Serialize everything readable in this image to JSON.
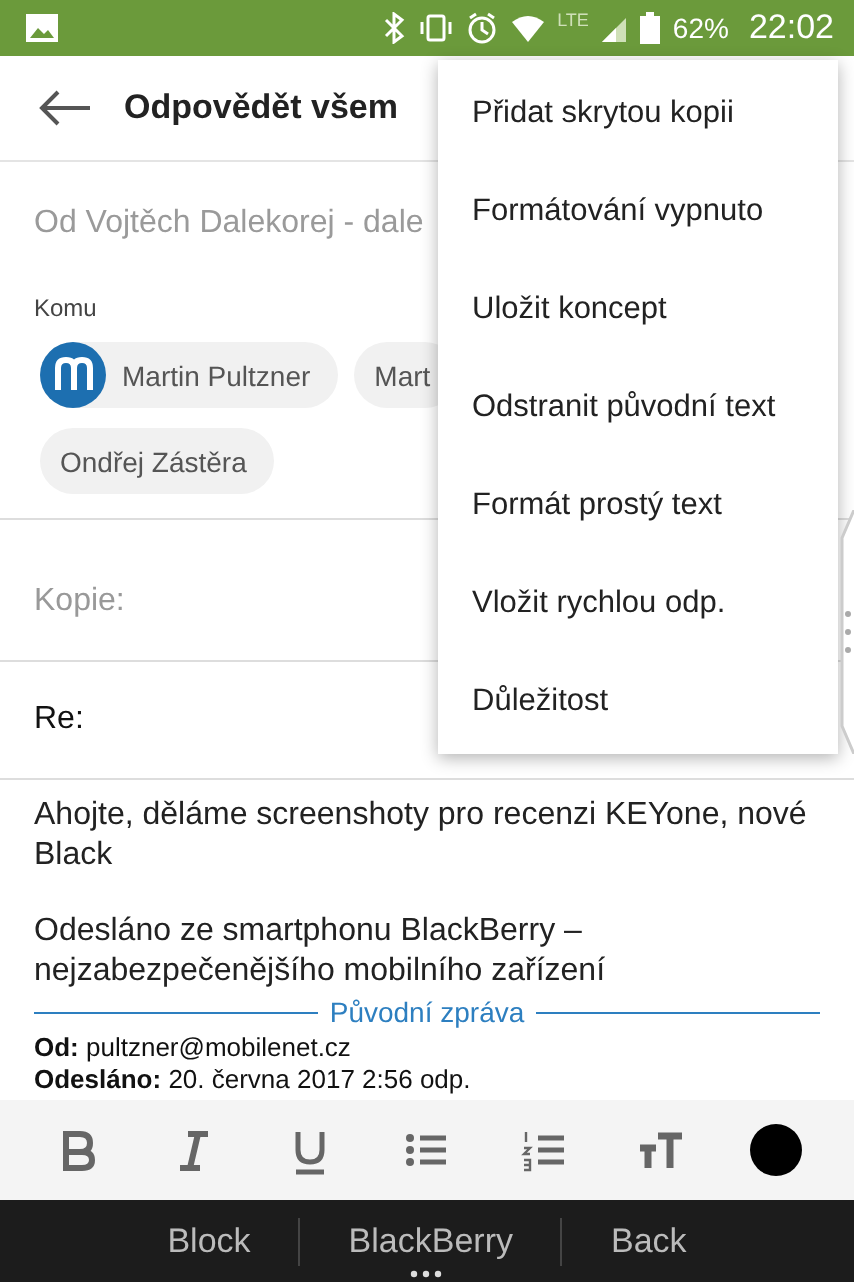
{
  "status_bar": {
    "network": "LTE",
    "battery": "62%",
    "time": "22:02"
  },
  "app_bar": {
    "title": "Odpovědět všem"
  },
  "from": {
    "label": "Od",
    "value": "Vojtěch Dalekorej - dale"
  },
  "to": {
    "label": "Komu",
    "recipients": [
      {
        "name": "Martin Pultzner",
        "kind": "avatar"
      },
      {
        "name": "Mart",
        "kind": "plain"
      },
      {
        "name": "Ondřej Zástěra",
        "kind": "plain"
      }
    ]
  },
  "cc": {
    "placeholder": "Kopie:"
  },
  "subject": {
    "value": "Re:"
  },
  "body": {
    "paragraphs": [
      "Ahojte, děláme screenshoty pro recenzi KEYone, nové Black",
      "Odesláno ze smartphonu BlackBerry – nejzabezpečenějšího mobilního zařízení"
    ],
    "divider_label": "Původní zpráva",
    "header_lines": [
      "**Od:** pultzner@mobilenet.cz",
      "**Odesláno:** 20. června 2017 2:56 odp."
    ]
  },
  "format_toolbar": [
    {
      "kind": "bold"
    },
    {
      "kind": "italic"
    },
    {
      "kind": "underline"
    },
    {
      "kind": "bullets"
    },
    {
      "kind": "numbers"
    },
    {
      "kind": "size"
    },
    {
      "kind": "color",
      "color": "#000000"
    }
  ],
  "menu": {
    "items": [
      "Přidat skrytou kopii",
      "Formátování vypnuto",
      "Uložit koncept",
      "Odstranit původní text",
      "Formát prostý text",
      "Vložit rychlou odp.",
      "Důležitost"
    ]
  },
  "nav_bar": [
    "Block",
    "BlackBerry",
    "Back"
  ]
}
